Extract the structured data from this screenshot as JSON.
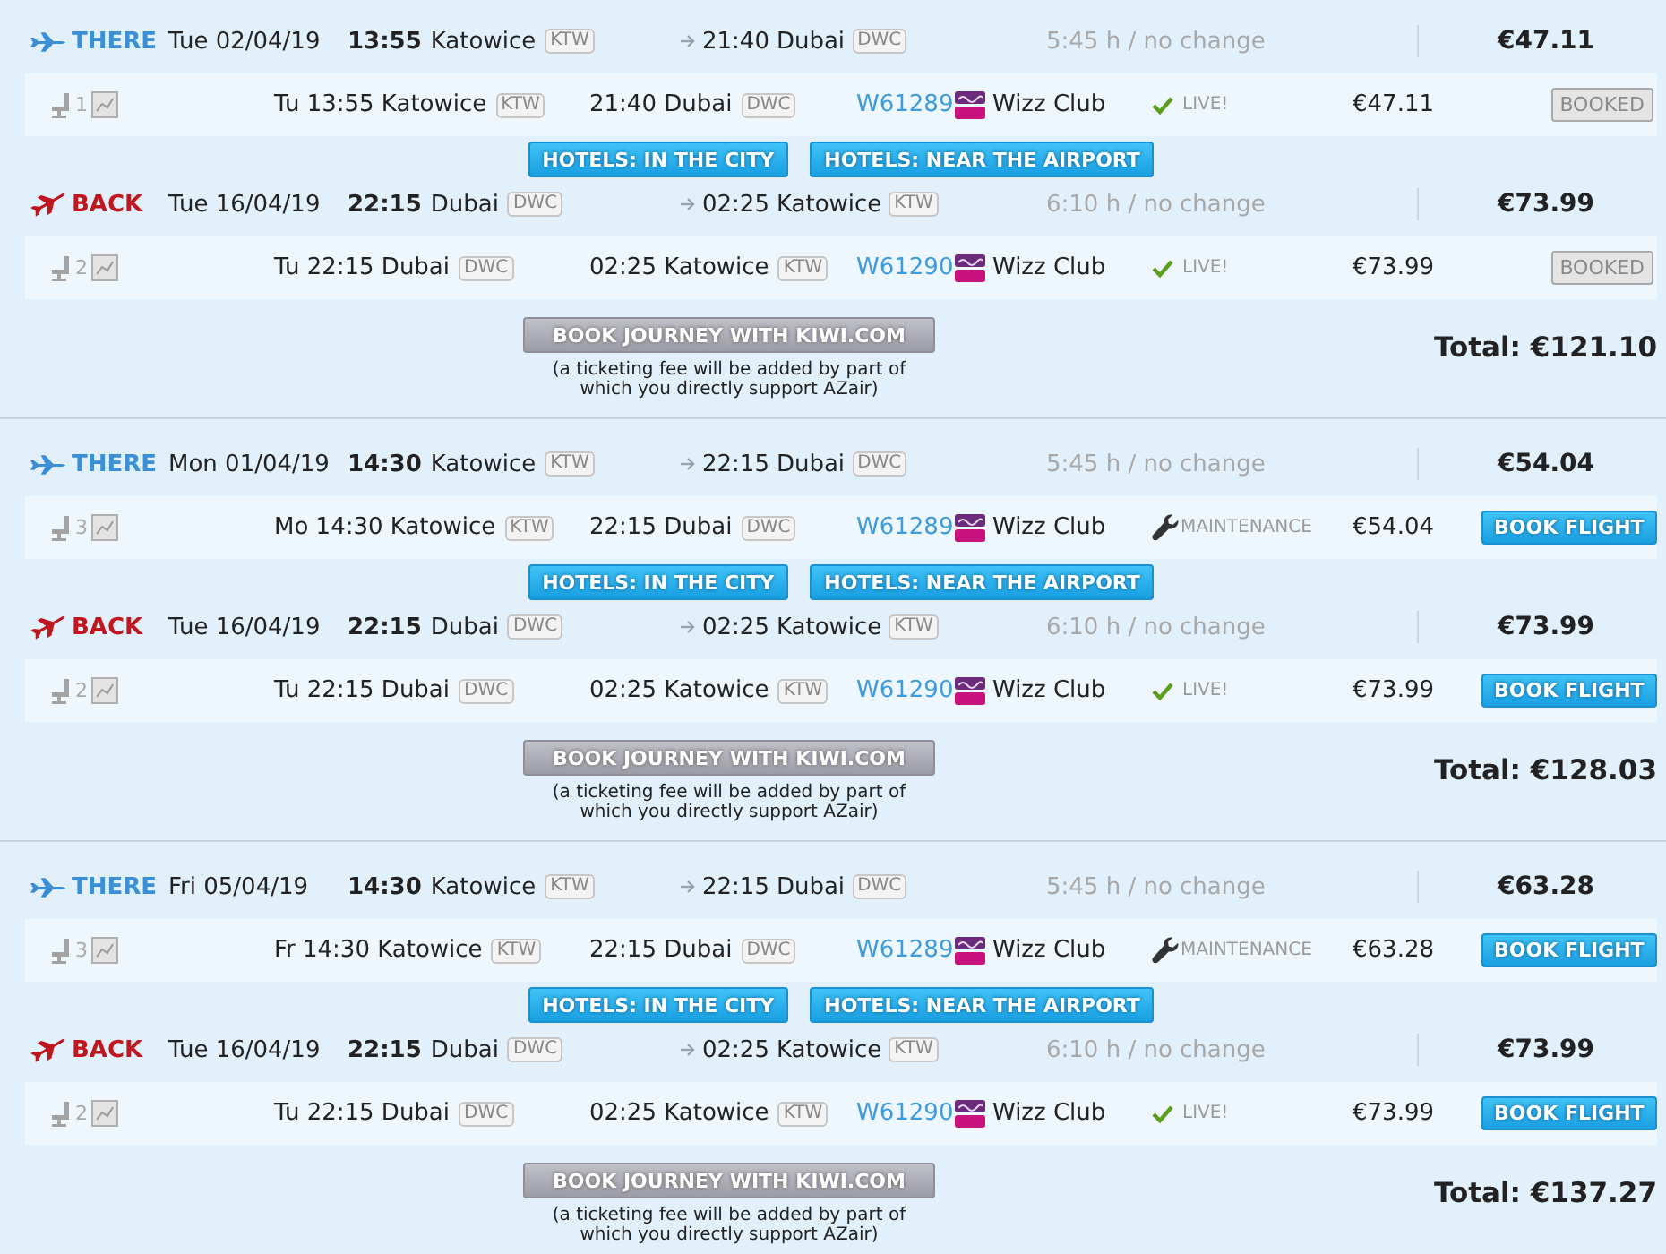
{
  "results": [
    {
      "legs": [
        {
          "kind": "there",
          "label": "THERE",
          "date": "Tue 02/04/19",
          "depart_time": "13:55",
          "depart_city": "Katowice",
          "depart_code": "KTW",
          "arrive_time": "21:40",
          "arrive_city": "Dubai",
          "arrive_code": "DWC",
          "duration": "5:45 h / no change",
          "price": "€47.11",
          "flight": {
            "seats": "1",
            "departure": "Tu 13:55 Katowice",
            "departure_code": "KTW",
            "arrival": "21:40 Dubai",
            "arrival_code": "DWC",
            "number": "W61289",
            "airline": "Wizz Club",
            "status": {
              "kind": "live",
              "text": "LIVE!"
            },
            "price": "€47.11",
            "action": {
              "kind": "booked",
              "label": "BOOKED"
            }
          },
          "hotels": [
            "HOTELS: IN THE CITY",
            "HOTELS: NEAR THE AIRPORT"
          ]
        },
        {
          "kind": "back",
          "label": "BACK",
          "date": "Tue 16/04/19",
          "depart_time": "22:15",
          "depart_city": "Dubai",
          "depart_code": "DWC",
          "arrive_time": "02:25",
          "arrive_city": "Katowice",
          "arrive_code": "KTW",
          "duration": "6:10 h / no change",
          "price": "€73.99",
          "flight": {
            "seats": "2",
            "departure": "Tu 22:15 Dubai",
            "departure_code": "DWC",
            "arrival": "02:25 Katowice",
            "arrival_code": "KTW",
            "number": "W61290",
            "airline": "Wizz Club",
            "status": {
              "kind": "live",
              "text": "LIVE!"
            },
            "price": "€73.99",
            "action": {
              "kind": "booked",
              "label": "BOOKED"
            }
          }
        }
      ],
      "book_button": "BOOK JOURNEY WITH KIWI.COM",
      "fee_note": "(a ticketing fee will be added by part of which you directly support AZair)",
      "total": "Total: €121.10"
    },
    {
      "legs": [
        {
          "kind": "there",
          "label": "THERE",
          "date": "Mon 01/04/19",
          "depart_time": "14:30",
          "depart_city": "Katowice",
          "depart_code": "KTW",
          "arrive_time": "22:15",
          "arrive_city": "Dubai",
          "arrive_code": "DWC",
          "duration": "5:45 h / no change",
          "price": "€54.04",
          "flight": {
            "seats": "3",
            "departure": "Mo 14:30 Katowice",
            "departure_code": "KTW",
            "arrival": "22:15 Dubai",
            "arrival_code": "DWC",
            "number": "W61289",
            "airline": "Wizz Club",
            "status": {
              "kind": "maintenance",
              "text": "MAINTENANCE"
            },
            "price": "€54.04",
            "action": {
              "kind": "book",
              "label": "BOOK FLIGHT"
            }
          },
          "hotels": [
            "HOTELS: IN THE CITY",
            "HOTELS: NEAR THE AIRPORT"
          ]
        },
        {
          "kind": "back",
          "label": "BACK",
          "date": "Tue 16/04/19",
          "depart_time": "22:15",
          "depart_city": "Dubai",
          "depart_code": "DWC",
          "arrive_time": "02:25",
          "arrive_city": "Katowice",
          "arrive_code": "KTW",
          "duration": "6:10 h / no change",
          "price": "€73.99",
          "flight": {
            "seats": "2",
            "departure": "Tu 22:15 Dubai",
            "departure_code": "DWC",
            "arrival": "02:25 Katowice",
            "arrival_code": "KTW",
            "number": "W61290",
            "airline": "Wizz Club",
            "status": {
              "kind": "live",
              "text": "LIVE!"
            },
            "price": "€73.99",
            "action": {
              "kind": "book",
              "label": "BOOK FLIGHT"
            }
          }
        }
      ],
      "book_button": "BOOK JOURNEY WITH KIWI.COM",
      "fee_note": "(a ticketing fee will be added by part of which you directly support AZair)",
      "total": "Total: €128.03"
    },
    {
      "legs": [
        {
          "kind": "there",
          "label": "THERE",
          "date": "Fri 05/04/19",
          "depart_time": "14:30",
          "depart_city": "Katowice",
          "depart_code": "KTW",
          "arrive_time": "22:15",
          "arrive_city": "Dubai",
          "arrive_code": "DWC",
          "duration": "5:45 h / no change",
          "price": "€63.28",
          "flight": {
            "seats": "3",
            "departure": "Fr 14:30 Katowice",
            "departure_code": "KTW",
            "arrival": "22:15 Dubai",
            "arrival_code": "DWC",
            "number": "W61289",
            "airline": "Wizz Club",
            "status": {
              "kind": "maintenance",
              "text": "MAINTENANCE"
            },
            "price": "€63.28",
            "action": {
              "kind": "book",
              "label": "BOOK FLIGHT"
            }
          },
          "hotels": [
            "HOTELS: IN THE CITY",
            "HOTELS: NEAR THE AIRPORT"
          ]
        },
        {
          "kind": "back",
          "label": "BACK",
          "date": "Tue 16/04/19",
          "depart_time": "22:15",
          "depart_city": "Dubai",
          "depart_code": "DWC",
          "arrive_time": "02:25",
          "arrive_city": "Katowice",
          "arrive_code": "KTW",
          "duration": "6:10 h / no change",
          "price": "€73.99",
          "flight": {
            "seats": "2",
            "departure": "Tu 22:15 Dubai",
            "departure_code": "DWC",
            "arrival": "02:25 Katowice",
            "arrival_code": "KTW",
            "number": "W61290",
            "airline": "Wizz Club",
            "status": {
              "kind": "live",
              "text": "LIVE!"
            },
            "price": "€73.99",
            "action": {
              "kind": "book",
              "label": "BOOK FLIGHT"
            }
          }
        }
      ],
      "book_button": "BOOK JOURNEY WITH KIWI.COM",
      "fee_note": "(a ticketing fee will be added by part of which you directly support AZair)",
      "total": "Total: €137.27"
    }
  ]
}
